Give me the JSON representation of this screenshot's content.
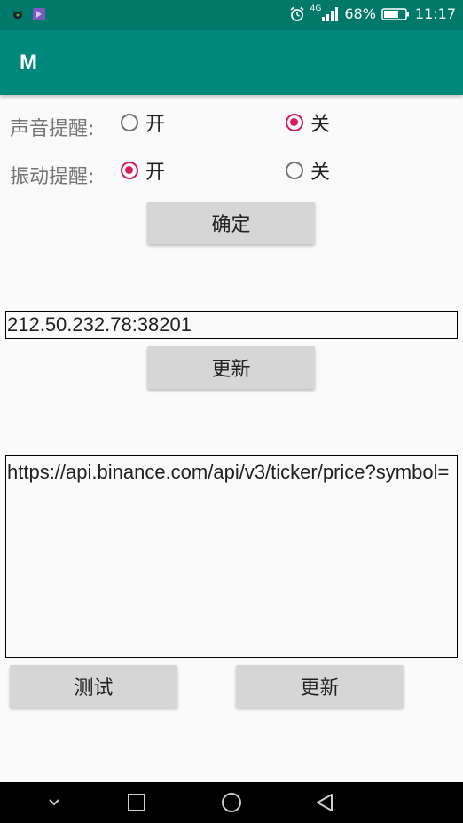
{
  "status_bar": {
    "battery": "68%",
    "time": "11:17",
    "network": "4G"
  },
  "app_bar": {
    "title": "M"
  },
  "settings": {
    "sound": {
      "label": "声音提醒:",
      "on_label": "开",
      "off_label": "关",
      "selected": "off"
    },
    "vibration": {
      "label": "振动提醒:",
      "on_label": "开",
      "off_label": "关",
      "selected": "on"
    },
    "confirm_label": "确定"
  },
  "server": {
    "address": "212.50.232.78:38201",
    "update_label": "更新"
  },
  "api": {
    "url": "https://api.binance.com/api/v3/ticker/price?symbol=",
    "test_label": "测试",
    "update_label": "更新"
  },
  "colors": {
    "status_bar": "#00796b",
    "app_bar": "#00897b",
    "accent": "#d81b60"
  }
}
